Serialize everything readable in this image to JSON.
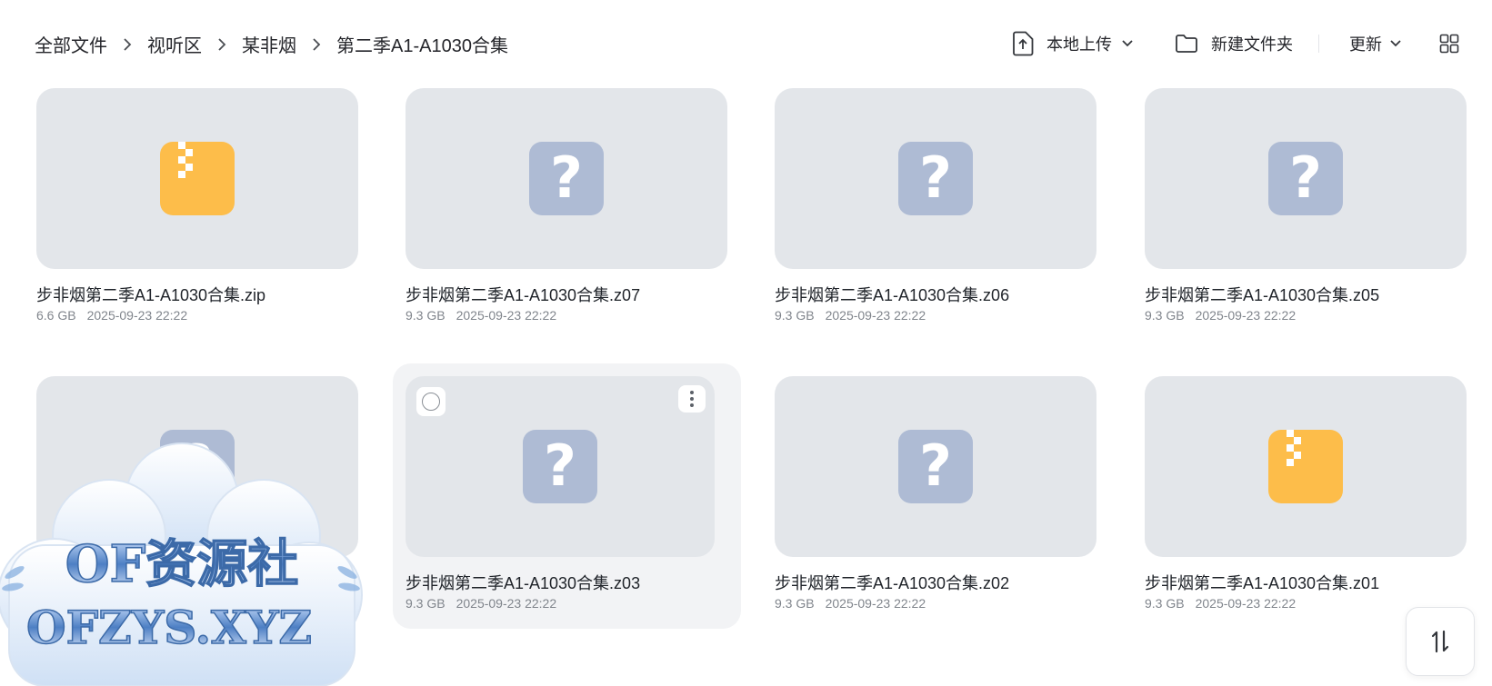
{
  "breadcrumb": [
    "全部文件",
    "视听区",
    "某非烟",
    "第二季A1-A1030合集"
  ],
  "toolbar": {
    "upload_label": "本地上传",
    "new_folder_label": "新建文件夹",
    "sort_label": "更新"
  },
  "files": [
    {
      "name": "步非烟第二季A1-A1030合集.zip",
      "size": "6.6 GB",
      "date": "2025-09-23 22:22",
      "icon": "zip-archive-icon"
    },
    {
      "name": "步非烟第二季A1-A1030合集.z07",
      "size": "9.3 GB",
      "date": "2025-09-23 22:22",
      "icon": "unknown-file-icon"
    },
    {
      "name": "步非烟第二季A1-A1030合集.z06",
      "size": "9.3 GB",
      "date": "2025-09-23 22:22",
      "icon": "unknown-file-icon"
    },
    {
      "name": "步非烟第二季A1-A1030合集.z05",
      "size": "9.3 GB",
      "date": "2025-09-23 22:22",
      "icon": "unknown-file-icon"
    },
    {
      "name": "",
      "size": "",
      "date": "",
      "icon": "unknown-file-icon"
    },
    {
      "name": "步非烟第二季A1-A1030合集.z03",
      "size": "9.3 GB",
      "date": "2025-09-23 22:22",
      "icon": "unknown-file-icon"
    },
    {
      "name": "步非烟第二季A1-A1030合集.z02",
      "size": "9.3 GB",
      "date": "2025-09-23 22:22",
      "icon": "unknown-file-icon"
    },
    {
      "name": "步非烟第二季A1-A1030合集.z01",
      "size": "9.3 GB",
      "date": "2025-09-23 22:22",
      "icon": "zip-archive-icon"
    }
  ],
  "watermark": {
    "line1": "OF资源社",
    "line2": "OFZYS.XYZ"
  },
  "colors": {
    "thumb_bg": "#e3e6ea",
    "unknown_icon": "#aebbd4",
    "zip_icon": "#fdbd4a",
    "meta_text": "#80858c"
  }
}
